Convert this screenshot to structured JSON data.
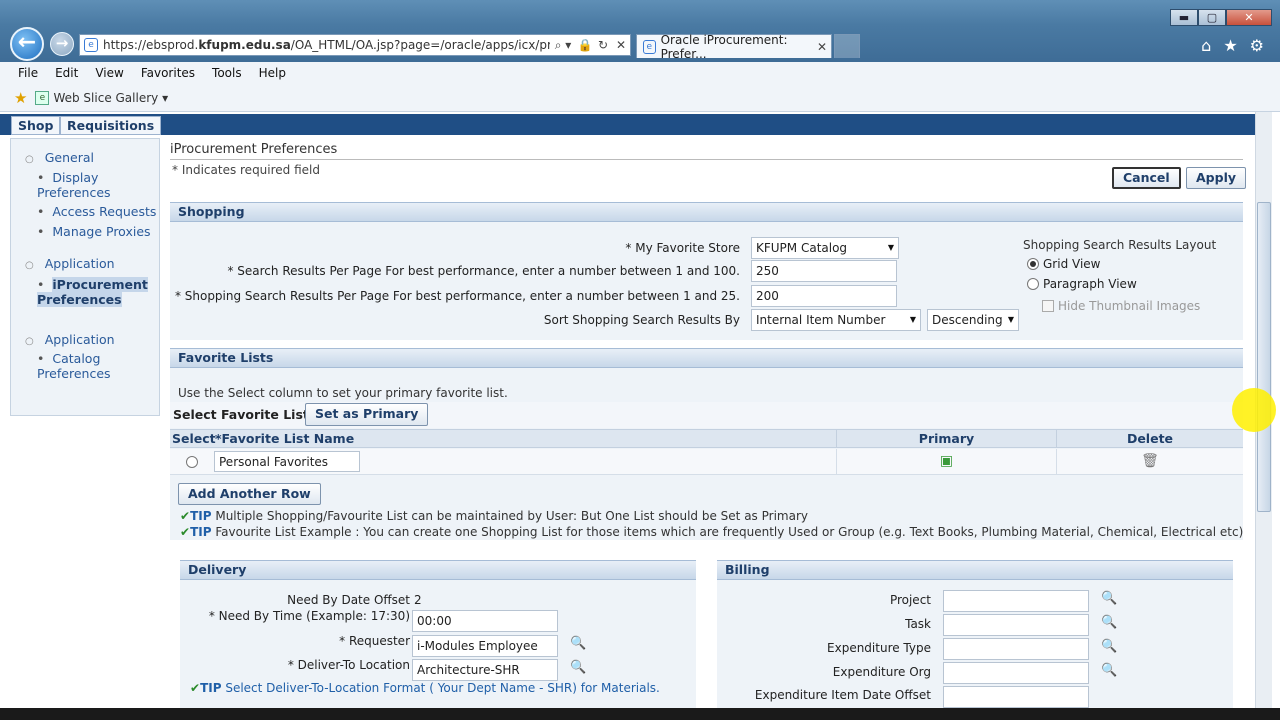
{
  "browser": {
    "url_prefix": "https://ebsprod.",
    "url_domain": "kfupm.edu.sa",
    "url_rest": "/OA_HTML/OA.jsp?page=/oracle/apps/icx/profile/wel",
    "tab_title": "Oracle iProcurement: Prefer...",
    "tab_close": "✕",
    "addr_search": "⌕ ▾",
    "addr_lock": "🔒",
    "addr_refresh": "↻",
    "addr_stop": "✕",
    "home_icon": "⌂",
    "star_icon": "★",
    "gear_icon": "⚙",
    "min": "▬",
    "max": "▢",
    "close": "✕",
    "back": "←",
    "forward": "→"
  },
  "menu": [
    "File",
    "Edit",
    "View",
    "Favorites",
    "Tools",
    "Help"
  ],
  "favorites_bar": {
    "web_slice": "Web Slice Gallery ▾"
  },
  "top_tabs": {
    "shop": "Shop",
    "requisitions": "Requisitions"
  },
  "sidebar": {
    "general": "General",
    "display_prefs_1": "Display",
    "display_prefs_2": "Preferences",
    "access_requests": "Access Requests",
    "manage_proxies": "Manage Proxies",
    "application_1": "Application",
    "iproc_1": "iProcurement",
    "iproc_2": "Preferences",
    "application_2": "Application",
    "catalog_1": "Catalog",
    "catalog_2": "Preferences"
  },
  "page": {
    "title": "iProcurement Preferences",
    "required_note": "* Indicates required field",
    "cancel": "Cancel",
    "apply": "Apply"
  },
  "shopping": {
    "header": "Shopping",
    "fav_store_label": "* My Favorite Store",
    "fav_store_value": "KFUPM Catalog",
    "search_per_page_label": "* Search Results Per Page For best performance, enter a number between 1 and 100.",
    "search_per_page_value": "250",
    "shop_per_page_label": "* Shopping Search Results Per Page For best performance, enter a number between 1 and 25.",
    "shop_per_page_value": "200",
    "sort_label": "Sort Shopping Search Results By",
    "sort_value": "Internal Item Number",
    "sort_order": "Descending",
    "layout_label": "Shopping Search Results Layout",
    "grid_view": "Grid View",
    "paragraph_view": "Paragraph View",
    "hide_thumbs": "Hide Thumbnail Images"
  },
  "favorites": {
    "header": "Favorite Lists",
    "instructions": "Use the Select column to set your primary favorite list.",
    "select_label": "Select Favorite List:",
    "set_primary": "Set as Primary",
    "col_select": "Select",
    "col_name": "*Favorite List Name",
    "col_primary": "Primary",
    "col_delete": "Delete",
    "rows": [
      {
        "name": "Personal Favorites"
      }
    ],
    "add_row": "Add Another Row",
    "tip1": "Multiple Shopping/Favourite List can be maintained by User: But One List should be Set as Primary",
    "tip2": "Favourite List Example : You can create one Shopping List for those items which are frequently Used or Group (e.g. Text Books, Plumbing Material, Chemical, Electrical etc)",
    "tip_word": "TIP",
    "trash_icon": "🗑",
    "primary_icon": "▣"
  },
  "delivery": {
    "header": "Delivery",
    "offset_label": "Need By Date Offset",
    "offset_value": "2",
    "time_label": "* Need By Time (Example: 17:30)",
    "time_value": "00:00",
    "requester_label": "* Requester",
    "requester_value": "i-Modules Employee",
    "deliver_label": "* Deliver-To Location",
    "deliver_value": "Architecture-SHR",
    "tip": "Select Deliver-To-Location Format ( Your Dept Name - SHR) for Materials."
  },
  "billing": {
    "header": "Billing",
    "project": "Project",
    "task": "Task",
    "exp_type": "Expenditure Type",
    "exp_org": "Expenditure Org",
    "exp_date": "Expenditure Item Date Offset"
  },
  "lookup_icon": "🔍"
}
